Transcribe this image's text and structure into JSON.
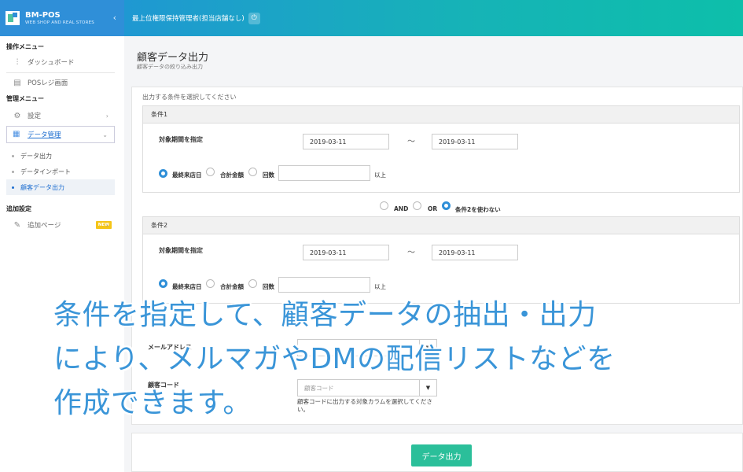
{
  "header": {
    "brand_name": "BM-POS",
    "brand_sub": "WEB SHOP AND REAL STORES",
    "user": "最上位権限保持管理者(担当店舗なし)"
  },
  "sidebar": {
    "section_ops": "操作メニュー",
    "dashboard": "ダッシュボード",
    "pos": "POSレジ画面",
    "section_admin": "管理メニュー",
    "settings": "設定",
    "data_mgmt": "データ管理",
    "sub_items": [
      "データ出力",
      "データインポート",
      "顧客データ出力"
    ],
    "section_extra": "追加設定",
    "add_page": "追加ページ",
    "new_badge": "NEW"
  },
  "page": {
    "title": "顧客データ出力",
    "subtitle": "顧客データの絞り込み出力",
    "intro": "出力する条件を選択してください"
  },
  "cond1": {
    "title": "条件1",
    "period_label": "対象期間を指定",
    "date_from": "2019-03-11",
    "tilde": "〜",
    "date_to": "2019-03-11",
    "opt_last_visit": "最終来店日",
    "opt_total": "合計金額",
    "opt_count": "回数",
    "suffix": "以上"
  },
  "join": {
    "and": "AND",
    "or": "OR",
    "not_use": "条件2を使わない"
  },
  "cond2": {
    "title": "条件2",
    "period_label": "対象期間を指定",
    "date_from": "2019-03-11",
    "tilde": "〜",
    "date_to": "2019-03-11",
    "opt_last_visit": "最終来店日",
    "opt_total": "合計金額",
    "opt_count": "回数",
    "suffix": "以上"
  },
  "output_fields": {
    "mail_label": "メールアドレス",
    "code_label": "顧客コード",
    "code_placeholder": "顧客コード",
    "code_help": "顧客コードに出力する対象カラムを選択してください。"
  },
  "actions": {
    "export": "データ出力"
  },
  "overlay": {
    "line1": "条件を指定して、顧客データの抽出・出力",
    "line2": "により、メルマガやDMの配信リストなどを",
    "line3": "作成できます。"
  }
}
